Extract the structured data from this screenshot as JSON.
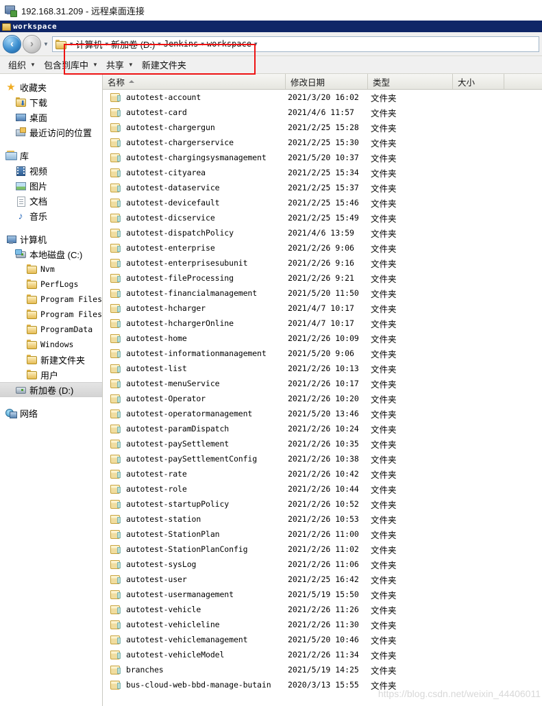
{
  "rdp": {
    "title": "192.168.31.209 - 远程桌面连接",
    "icon": "remote-desktop-icon"
  },
  "window": {
    "caption": "workspace",
    "caption_icon": "folder-icon"
  },
  "nav": {
    "back_icon": "back-arrow-icon",
    "forward_icon": "forward-arrow-icon",
    "history_icon": "chevron-down-icon",
    "address_folder_icon": "folder-icon",
    "separator": "▸",
    "breadcrumbs": [
      {
        "label": "计算机",
        "cn": true
      },
      {
        "label": "新加卷 (D:)",
        "cn": true
      },
      {
        "label": "Jenkins",
        "cn": false
      },
      {
        "label": "workspace",
        "cn": false
      }
    ]
  },
  "toolbar": {
    "items": [
      {
        "label": "组织",
        "caret": true
      },
      {
        "label": "包含到库中",
        "caret": true
      },
      {
        "label": "共享",
        "caret": true
      },
      {
        "label": "新建文件夹",
        "caret": false
      }
    ],
    "caret_glyph": "▼"
  },
  "annotation": {
    "highlight_color": "#ee1111",
    "name": "red-highlight-rectangle"
  },
  "tree": {
    "nodes": [
      {
        "label": "收藏夹",
        "level": 0,
        "icon": "star-icon",
        "mono": false,
        "selected": false
      },
      {
        "label": "下载",
        "level": 1,
        "icon": "download-folder-icon",
        "mono": false,
        "selected": false
      },
      {
        "label": "桌面",
        "level": 1,
        "icon": "desktop-icon",
        "mono": false,
        "selected": false
      },
      {
        "label": "最近访问的位置",
        "level": 1,
        "icon": "recent-places-icon",
        "mono": false,
        "selected": false
      },
      {
        "gap": true
      },
      {
        "label": "库",
        "level": 0,
        "icon": "library-icon",
        "mono": false,
        "selected": false
      },
      {
        "label": "视频",
        "level": 1,
        "icon": "video-icon",
        "mono": false,
        "selected": false
      },
      {
        "label": "图片",
        "level": 1,
        "icon": "pictures-icon",
        "mono": false,
        "selected": false
      },
      {
        "label": "文档",
        "level": 1,
        "icon": "documents-icon",
        "mono": false,
        "selected": false
      },
      {
        "label": "音乐",
        "level": 1,
        "icon": "music-icon",
        "mono": false,
        "selected": false
      },
      {
        "gap": true
      },
      {
        "label": "计算机",
        "level": 0,
        "icon": "computer-icon",
        "mono": false,
        "selected": false
      },
      {
        "label": "本地磁盘 (C:)",
        "level": 1,
        "icon": "harddisk-icon",
        "mono": false,
        "selected": false
      },
      {
        "label": "Nvm",
        "level": 2,
        "icon": "folder-icon",
        "mono": true,
        "selected": false
      },
      {
        "label": "PerfLogs",
        "level": 2,
        "icon": "folder-icon",
        "mono": true,
        "selected": false
      },
      {
        "label": "Program Files",
        "level": 2,
        "icon": "folder-icon",
        "mono": true,
        "selected": false
      },
      {
        "label": "Program Files (x",
        "level": 2,
        "icon": "folder-icon",
        "mono": true,
        "selected": false
      },
      {
        "label": "ProgramData",
        "level": 2,
        "icon": "folder-icon",
        "mono": true,
        "selected": false
      },
      {
        "label": "Windows",
        "level": 2,
        "icon": "folder-icon",
        "mono": true,
        "selected": false
      },
      {
        "label": "新建文件夹",
        "level": 2,
        "icon": "folder-icon",
        "mono": false,
        "selected": false
      },
      {
        "label": "用户",
        "level": 2,
        "icon": "folder-icon",
        "mono": false,
        "selected": false
      },
      {
        "label": "新加卷 (D:)",
        "level": 1,
        "icon": "drive-icon",
        "mono": false,
        "selected": true
      },
      {
        "gap": true
      },
      {
        "label": "网络",
        "level": 0,
        "icon": "network-icon",
        "mono": false,
        "selected": false
      }
    ]
  },
  "file_list": {
    "columns": [
      {
        "label": "名称",
        "sorted": true
      },
      {
        "label": "修改日期",
        "sorted": false
      },
      {
        "label": "类型",
        "sorted": false
      },
      {
        "label": "大小",
        "sorted": false
      },
      {
        "label": "",
        "sorted": false
      }
    ],
    "rows": [
      {
        "name": "autotest-account",
        "date": "2021/3/20 16:02",
        "type": "文件夹",
        "size": ""
      },
      {
        "name": "autotest-card",
        "date": "2021/4/6 11:57",
        "type": "文件夹",
        "size": ""
      },
      {
        "name": "autotest-chargergun",
        "date": "2021/2/25 15:28",
        "type": "文件夹",
        "size": ""
      },
      {
        "name": "autotest-chargerservice",
        "date": "2021/2/25 15:30",
        "type": "文件夹",
        "size": ""
      },
      {
        "name": "autotest-chargingsysmanagement",
        "date": "2021/5/20 10:37",
        "type": "文件夹",
        "size": ""
      },
      {
        "name": "autotest-cityarea",
        "date": "2021/2/25 15:34",
        "type": "文件夹",
        "size": ""
      },
      {
        "name": "autotest-dataservice",
        "date": "2021/2/25 15:37",
        "type": "文件夹",
        "size": ""
      },
      {
        "name": "autotest-devicefault",
        "date": "2021/2/25 15:46",
        "type": "文件夹",
        "size": ""
      },
      {
        "name": "autotest-dicservice",
        "date": "2021/2/25 15:49",
        "type": "文件夹",
        "size": ""
      },
      {
        "name": "autotest-dispatchPolicy",
        "date": "2021/4/6 13:59",
        "type": "文件夹",
        "size": ""
      },
      {
        "name": "autotest-enterprise",
        "date": "2021/2/26 9:06",
        "type": "文件夹",
        "size": ""
      },
      {
        "name": "autotest-enterprisesubunit",
        "date": "2021/2/26 9:16",
        "type": "文件夹",
        "size": ""
      },
      {
        "name": "autotest-fileProcessing",
        "date": "2021/2/26 9:21",
        "type": "文件夹",
        "size": ""
      },
      {
        "name": "autotest-financialmanagement",
        "date": "2021/5/20 11:50",
        "type": "文件夹",
        "size": ""
      },
      {
        "name": "autotest-hcharger",
        "date": "2021/4/7 10:17",
        "type": "文件夹",
        "size": ""
      },
      {
        "name": "autotest-hchargerOnline",
        "date": "2021/4/7 10:17",
        "type": "文件夹",
        "size": ""
      },
      {
        "name": "autotest-home",
        "date": "2021/2/26 10:09",
        "type": "文件夹",
        "size": ""
      },
      {
        "name": "autotest-informationmanagement",
        "date": "2021/5/20 9:06",
        "type": "文件夹",
        "size": ""
      },
      {
        "name": "autotest-list",
        "date": "2021/2/26 10:13",
        "type": "文件夹",
        "size": ""
      },
      {
        "name": "autotest-menuService",
        "date": "2021/2/26 10:17",
        "type": "文件夹",
        "size": ""
      },
      {
        "name": "autotest-Operator",
        "date": "2021/2/26 10:20",
        "type": "文件夹",
        "size": ""
      },
      {
        "name": "autotest-operatormanagement",
        "date": "2021/5/20 13:46",
        "type": "文件夹",
        "size": ""
      },
      {
        "name": "autotest-paramDispatch",
        "date": "2021/2/26 10:24",
        "type": "文件夹",
        "size": ""
      },
      {
        "name": "autotest-paySettlement",
        "date": "2021/2/26 10:35",
        "type": "文件夹",
        "size": ""
      },
      {
        "name": "autotest-paySettlementConfig",
        "date": "2021/2/26 10:38",
        "type": "文件夹",
        "size": ""
      },
      {
        "name": "autotest-rate",
        "date": "2021/2/26 10:42",
        "type": "文件夹",
        "size": ""
      },
      {
        "name": "autotest-role",
        "date": "2021/2/26 10:44",
        "type": "文件夹",
        "size": ""
      },
      {
        "name": "autotest-startupPolicy",
        "date": "2021/2/26 10:52",
        "type": "文件夹",
        "size": ""
      },
      {
        "name": "autotest-station",
        "date": "2021/2/26 10:53",
        "type": "文件夹",
        "size": ""
      },
      {
        "name": "autotest-StationPlan",
        "date": "2021/2/26 11:00",
        "type": "文件夹",
        "size": ""
      },
      {
        "name": "autotest-StationPlanConfig",
        "date": "2021/2/26 11:02",
        "type": "文件夹",
        "size": ""
      },
      {
        "name": "autotest-sysLog",
        "date": "2021/2/26 11:06",
        "type": "文件夹",
        "size": ""
      },
      {
        "name": "autotest-user",
        "date": "2021/2/25 16:42",
        "type": "文件夹",
        "size": ""
      },
      {
        "name": "autotest-usermanagement",
        "date": "2021/5/19 15:50",
        "type": "文件夹",
        "size": ""
      },
      {
        "name": "autotest-vehicle",
        "date": "2021/2/26 11:26",
        "type": "文件夹",
        "size": ""
      },
      {
        "name": "autotest-vehicleline",
        "date": "2021/2/26 11:30",
        "type": "文件夹",
        "size": ""
      },
      {
        "name": "autotest-vehiclemanagement",
        "date": "2021/5/20 10:46",
        "type": "文件夹",
        "size": ""
      },
      {
        "name": "autotest-vehicleModel",
        "date": "2021/2/26 11:34",
        "type": "文件夹",
        "size": ""
      },
      {
        "name": "branches",
        "date": "2021/5/19 14:25",
        "type": "文件夹",
        "size": ""
      },
      {
        "name": "bus-cloud-web-bbd-manage-butain",
        "date": "2020/3/13 15:55",
        "type": "文件夹",
        "size": ""
      }
    ]
  },
  "watermark": {
    "text": "https://blog.csdn.net/weixin_44406011"
  }
}
